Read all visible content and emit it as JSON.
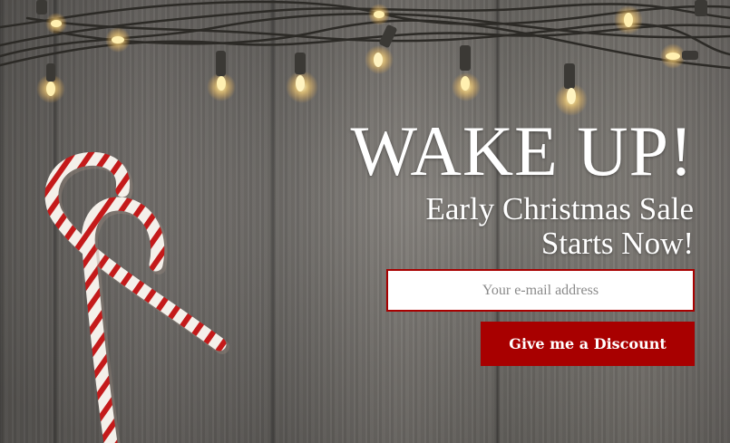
{
  "popup": {
    "headline": "WAKE UP!",
    "subline_1": "Early Christmas Sale",
    "subline_2": "Starts Now!",
    "email_placeholder": "Your e-mail address",
    "email_value": "",
    "cta_label": "Give me a Discount"
  },
  "decor": {
    "background": "rustic-wood-planks",
    "lights": "string-lights-icon",
    "candy_canes": "candy-cane-icon"
  },
  "colors": {
    "accent": "#a80000",
    "text": "#ffffff",
    "input_bg": "#ffffff",
    "placeholder": "#8a8a8a"
  }
}
